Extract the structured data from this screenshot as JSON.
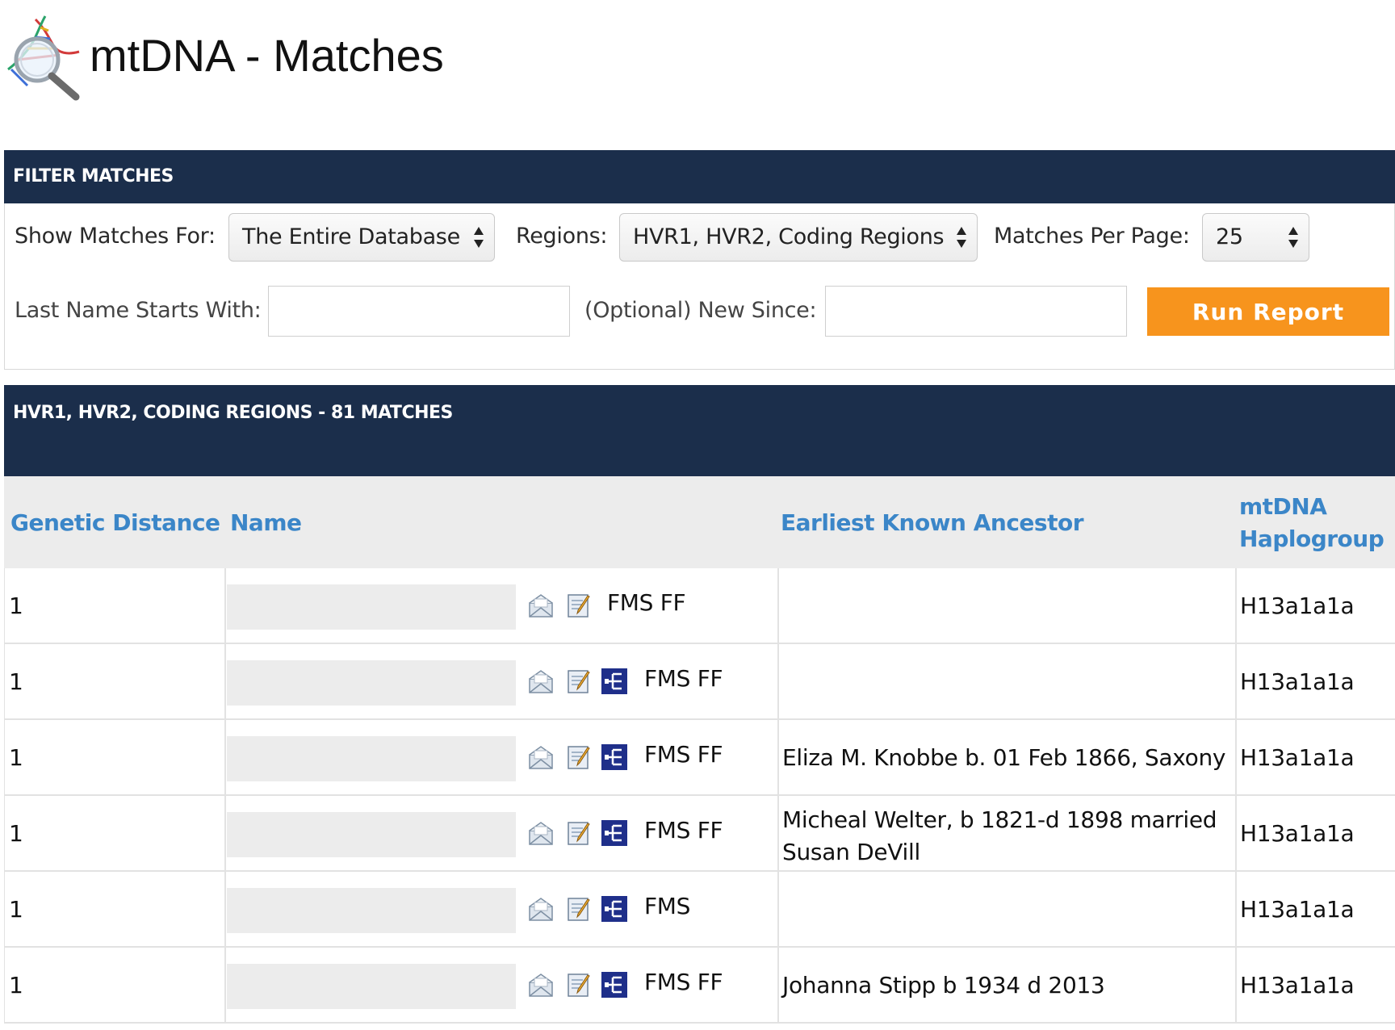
{
  "header": {
    "title": "mtDNA - Matches",
    "logo_icon": "dna-magnifier-icon"
  },
  "filter": {
    "section_title": "FILTER MATCHES",
    "show_matches_label": "Show Matches For:",
    "show_matches_value": "The Entire Database",
    "regions_label": "Regions:",
    "regions_value": "HVR1, HVR2, Coding Regions",
    "per_page_label": "Matches Per Page:",
    "per_page_value": "25",
    "last_name_label": "Last Name Starts With:",
    "last_name_value": "",
    "new_since_label": "(Optional) New Since:",
    "new_since_value": "",
    "run_button": "Run Report"
  },
  "results": {
    "section_title": "HVR1, HVR2, CODING REGIONS - 81 MATCHES",
    "columns": {
      "genetic_distance": "Genetic Distance",
      "name": "Name",
      "earliest_ancestor": "Earliest Known Ancestor",
      "haplogroup_line1": "mtDNA",
      "haplogroup_line2": "Haplogroup"
    },
    "rows": [
      {
        "distance": "1",
        "tree": false,
        "links": "FMS  FF",
        "ancestor": "",
        "haplogroup": "H13a1a1a"
      },
      {
        "distance": "1",
        "tree": true,
        "links": "FMS  FF",
        "ancestor": "",
        "haplogroup": "H13a1a1a"
      },
      {
        "distance": "1",
        "tree": true,
        "links": "FMS  FF",
        "ancestor": "Eliza M. Knobbe b. 01 Feb 1866, Saxony",
        "haplogroup": "H13a1a1a"
      },
      {
        "distance": "1",
        "tree": true,
        "links": "FMS  FF",
        "ancestor": "Micheal Welter, b 1821-d 1898 married Susan DeVill",
        "haplogroup": "H13a1a1a"
      },
      {
        "distance": "1",
        "tree": true,
        "links": "FMS",
        "ancestor": "",
        "haplogroup": "H13a1a1a"
      },
      {
        "distance": "1",
        "tree": true,
        "links": "FMS  FF",
        "ancestor": "Johanna Stipp b 1934 d 2013",
        "haplogroup": "H13a1a1a"
      }
    ]
  },
  "colors": {
    "bar": "#1b2e4b",
    "header_link": "#3b86c8",
    "run_button": "#f7941d"
  }
}
